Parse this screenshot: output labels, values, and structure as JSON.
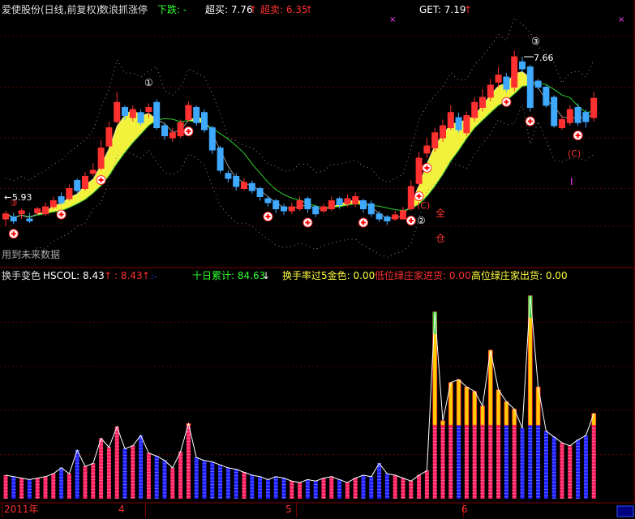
{
  "header": {
    "title": "爱使股份(日线,前复权)",
    "indicator": "数浪抓涨停",
    "down_label": "下跌: -",
    "buy_label": "超买: 7.76",
    "sell_label": "超卖: 6.35",
    "get_label": "GET: 7.19",
    "future_note": "用到未来数据"
  },
  "lower_header": {
    "name": "换手变色",
    "hscol": "HSCOL: 8.43",
    "hscol2": ": 8.43",
    "ten_day": "十日累计: 84.63",
    "over5": "换手率过5金色: 0.00",
    "low_in": "低位绿庄家进货: 0.00",
    "high_out": "高位绿庄家出货: 0.00"
  },
  "annotations": {
    "circle_1": "①",
    "circle_2": "②",
    "circle_3": "③",
    "label_3": "③",
    "label_c1": "(C)",
    "label_c2": "(C)",
    "label_full": "全",
    "label_cang": "仓",
    "label_i": "I",
    "high_price": "7.66",
    "low_price": "5.93"
  },
  "timeline": {
    "year": "2011年",
    "months": [
      "4",
      "5",
      "6"
    ]
  },
  "colors": {
    "up": "#ff3030",
    "down": "#3fa8ff",
    "band": "#ffff40",
    "ma": "#ffff80",
    "guide": "#30d030",
    "vol_hi": "#ffcc00",
    "vol_blue": "#2020ff",
    "vol_red": "#ff2060",
    "green_cap": "#30d030"
  },
  "chart_data": [
    {
      "type": "candlestick",
      "title": "爱使股份(日线,前复权)",
      "x": [
        "2011-03-08",
        "2011-03-09",
        "2011-03-10",
        "2011-03-11",
        "2011-03-14",
        "2011-03-15",
        "2011-03-16",
        "2011-03-17",
        "2011-03-18",
        "2011-03-21",
        "2011-03-22",
        "2011-03-23",
        "2011-03-24",
        "2011-03-25",
        "2011-03-28",
        "2011-03-29",
        "2011-03-30",
        "2011-03-31",
        "2011-04-01",
        "2011-04-06",
        "2011-04-07",
        "2011-04-08",
        "2011-04-11",
        "2011-04-12",
        "2011-04-13",
        "2011-04-14",
        "2011-04-15",
        "2011-04-18",
        "2011-04-19",
        "2011-04-20",
        "2011-04-21",
        "2011-04-22",
        "2011-04-25",
        "2011-04-26",
        "2011-04-27",
        "2011-04-28",
        "2011-04-29",
        "2011-05-03",
        "2011-05-04",
        "2011-05-05",
        "2011-05-06",
        "2011-05-09",
        "2011-05-10",
        "2011-05-11",
        "2011-05-12",
        "2011-05-13",
        "2011-05-16",
        "2011-05-17",
        "2011-05-18",
        "2011-05-19",
        "2011-05-20",
        "2011-05-23",
        "2011-05-24",
        "2011-05-25",
        "2011-05-26",
        "2011-05-27",
        "2011-05-30",
        "2011-05-31",
        "2011-06-01",
        "2011-06-02",
        "2011-06-03",
        "2011-06-07",
        "2011-06-08",
        "2011-06-09",
        "2011-06-10",
        "2011-06-13",
        "2011-06-14",
        "2011-06-15",
        "2011-06-16",
        "2011-06-17",
        "2011-06-20",
        "2011-06-21",
        "2011-06-22",
        "2011-06-23",
        "2011-06-24"
      ],
      "open": [
        6.0,
        6.02,
        6.05,
        6.0,
        6.06,
        6.05,
        6.12,
        6.22,
        6.2,
        6.38,
        6.3,
        6.45,
        6.5,
        6.72,
        6.96,
        7.1,
        7.0,
        7.05,
        7.06,
        7.15,
        6.92,
        6.8,
        6.82,
        6.98,
        7.1,
        7.05,
        6.9,
        6.7,
        6.45,
        6.42,
        6.3,
        6.35,
        6.3,
        6.2,
        6.18,
        6.12,
        6.08,
        6.1,
        6.2,
        6.12,
        6.08,
        6.1,
        6.2,
        6.15,
        6.15,
        6.18,
        6.15,
        6.05,
        6.02,
        6.0,
        6.0,
        6.1,
        6.35,
        6.65,
        6.7,
        6.8,
        6.9,
        7.0,
        6.85,
        7.0,
        7.1,
        7.2,
        7.35,
        7.4,
        7.3,
        7.55,
        7.5,
        7.36,
        7.3,
        7.2,
        6.9,
        6.95,
        7.1,
        7.05,
        7.0
      ],
      "close": [
        6.05,
        5.98,
        6.08,
        5.98,
        6.1,
        6.12,
        6.18,
        6.16,
        6.3,
        6.28,
        6.42,
        6.48,
        6.7,
        6.9,
        7.15,
        7.02,
        7.08,
        6.95,
        7.1,
        6.9,
        6.82,
        6.85,
        6.95,
        7.12,
        6.95,
        6.88,
        6.68,
        6.48,
        6.4,
        6.32,
        6.36,
        6.28,
        6.22,
        6.16,
        6.1,
        6.08,
        6.12,
        6.18,
        6.1,
        6.05,
        6.12,
        6.18,
        6.14,
        6.2,
        6.22,
        6.1,
        6.05,
        6.0,
        5.98,
        6.04,
        6.08,
        6.32,
        6.6,
        6.72,
        6.85,
        6.92,
        7.05,
        6.88,
        7.02,
        7.15,
        7.2,
        7.32,
        7.42,
        7.28,
        7.6,
        7.48,
        7.1,
        7.3,
        7.12,
        6.92,
        6.98,
        7.08,
        6.95,
        6.96,
        7.19
      ],
      "high": [
        6.08,
        6.06,
        6.1,
        6.06,
        6.12,
        6.16,
        6.22,
        6.26,
        6.34,
        6.4,
        6.46,
        6.55,
        6.78,
        6.96,
        7.25,
        7.12,
        7.12,
        7.08,
        7.14,
        7.18,
        6.95,
        6.9,
        6.98,
        7.16,
        7.12,
        7.08,
        6.92,
        6.72,
        6.48,
        6.45,
        6.4,
        6.38,
        6.32,
        6.22,
        6.2,
        6.15,
        6.16,
        6.22,
        6.22,
        6.14,
        6.15,
        6.22,
        6.22,
        6.24,
        6.26,
        6.2,
        6.18,
        6.08,
        6.04,
        6.08,
        6.12,
        6.38,
        6.66,
        6.8,
        6.9,
        6.98,
        7.12,
        7.05,
        7.06,
        7.2,
        7.28,
        7.38,
        7.5,
        7.44,
        7.66,
        7.6,
        7.52,
        7.38,
        7.32,
        7.22,
        7.02,
        7.12,
        7.14,
        7.08,
        7.25
      ],
      "low": [
        5.93,
        5.95,
        6.0,
        5.96,
        6.04,
        6.03,
        6.1,
        6.14,
        6.18,
        6.25,
        6.28,
        6.42,
        6.48,
        6.7,
        6.94,
        6.98,
        6.96,
        6.92,
        7.0,
        6.88,
        6.78,
        6.76,
        6.8,
        6.96,
        6.92,
        6.85,
        6.64,
        6.45,
        6.36,
        6.28,
        6.28,
        6.25,
        6.18,
        6.12,
        6.06,
        6.04,
        6.05,
        6.08,
        6.06,
        6.02,
        6.06,
        6.08,
        6.1,
        6.12,
        6.12,
        6.06,
        6.02,
        5.97,
        5.94,
        5.98,
        6.0,
        6.08,
        6.32,
        6.6,
        6.66,
        6.76,
        6.88,
        6.85,
        6.82,
        6.96,
        7.06,
        7.16,
        7.3,
        7.25,
        7.26,
        7.45,
        7.06,
        7.28,
        7.1,
        6.9,
        6.88,
        6.92,
        6.92,
        6.9,
        6.96
      ],
      "ylim": [
        5.6,
        8.0
      ]
    },
    {
      "type": "bar",
      "title": "换手变色",
      "series": [
        {
          "name": "HSCOL",
          "values": [
            1.6,
            1.5,
            1.4,
            1.3,
            1.4,
            1.5,
            1.7,
            2.1,
            1.7,
            3.3,
            2.2,
            2.4,
            4.1,
            3.5,
            4.9,
            3.4,
            3.6,
            4.3,
            3.1,
            2.9,
            2.6,
            2.1,
            3.2,
            5.1,
            2.8,
            2.6,
            2.5,
            2.3,
            2.1,
            2.0,
            1.8,
            1.6,
            1.5,
            1.3,
            1.5,
            1.4,
            1.2,
            1.1,
            1.3,
            1.2,
            1.4,
            1.5,
            1.3,
            1.1,
            1.4,
            1.6,
            1.5,
            2.4,
            1.7,
            1.6,
            1.4,
            1.2,
            1.6,
            1.9,
            12.7,
            5.3,
            7.9,
            8.1,
            7.6,
            7.3,
            6.3,
            10.1,
            7.4,
            6.6,
            6.1,
            4.8,
            13.8,
            7.6,
            4.6,
            4.2,
            3.8,
            3.6,
            4.0,
            4.3,
            5.8
          ]
        }
      ],
      "ylim": [
        0,
        14.5
      ]
    }
  ]
}
